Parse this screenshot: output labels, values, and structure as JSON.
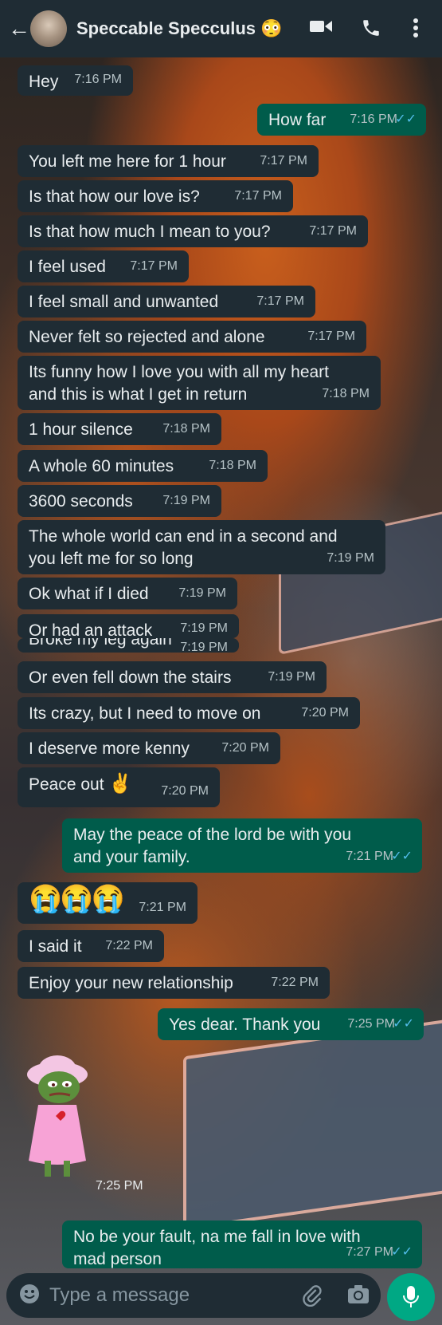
{
  "header": {
    "back_icon": "arrow-left-icon",
    "contact_name": "Speccable Specculus",
    "contact_emoji": "😳",
    "video_icon": "video-call-icon",
    "call_icon": "phone-icon",
    "menu_icon": "more-vert-icon"
  },
  "messages": [
    {
      "dir": "in",
      "text": "Hey",
      "time": "7:16 PM"
    },
    {
      "dir": "out",
      "text": "How far",
      "time": "7:16 PM"
    },
    {
      "dir": "in",
      "text": "You left me here for 1 hour",
      "time": "7:17 PM"
    },
    {
      "dir": "in",
      "text": "Is that how our love is?",
      "time": "7:17 PM"
    },
    {
      "dir": "in",
      "text": "Is that how much I mean to you?",
      "time": "7:17 PM"
    },
    {
      "dir": "in",
      "text": "I feel used",
      "time": "7:17 PM"
    },
    {
      "dir": "in",
      "text": "I feel small and unwanted",
      "time": "7:17 PM"
    },
    {
      "dir": "in",
      "text": "Never felt so rejected and alone",
      "time": "7:17 PM"
    },
    {
      "dir": "in",
      "text": "Its funny how I love you with all my heart",
      "text2": "and this is what I get in return",
      "time": "7:18 PM"
    },
    {
      "dir": "in",
      "text": "1 hour silence",
      "time": "7:18 PM"
    },
    {
      "dir": "in",
      "text": "A whole 60 minutes",
      "time": "7:18 PM"
    },
    {
      "dir": "in",
      "text": "3600 seconds",
      "time": "7:19 PM"
    },
    {
      "dir": "in",
      "text": "The whole world can end in a second and",
      "text2": "you left me for so long",
      "time": "7:19 PM"
    },
    {
      "dir": "in",
      "text": "Ok what if I died",
      "time": "7:19 PM"
    },
    {
      "dir": "in",
      "text": "Or had an attack",
      "time": "7:19 PM"
    },
    {
      "dir": "in",
      "text": "Broke my leg again",
      "time": "7:19 PM"
    },
    {
      "dir": "in",
      "text": "Or even fell down the stairs",
      "time": "7:19 PM"
    },
    {
      "dir": "in",
      "text": "Its crazy, but I need to move on",
      "time": "7:20 PM"
    },
    {
      "dir": "in",
      "text": "I deserve more kenny",
      "time": "7:20 PM"
    },
    {
      "dir": "in",
      "text": "Peace out",
      "emoji": "✌️",
      "time": "7:20 PM"
    },
    {
      "dir": "out",
      "text": "May the peace of the lord be with you",
      "text2": "and your family.",
      "time": "7:21 PM"
    },
    {
      "dir": "in",
      "text": "😭😭😭",
      "time": "7:21 PM"
    },
    {
      "dir": "in",
      "text": "I said it",
      "time": "7:22 PM"
    },
    {
      "dir": "in",
      "text": "Enjoy your new relationship",
      "time": "7:22 PM"
    },
    {
      "dir": "out",
      "text": "Yes dear. Thank you",
      "time": "7:25 PM"
    },
    {
      "dir": "in",
      "sticker": "sad-frog-sticker",
      "time": "7:25 PM"
    },
    {
      "dir": "out",
      "text": "No be your fault, na me fall in love with",
      "text2": "mad person",
      "time": "7:27 PM"
    }
  ],
  "composer": {
    "placeholder": "Type a message",
    "emoji_icon": "emoji-icon",
    "attach_icon": "paperclip-icon",
    "camera_icon": "camera-icon",
    "mic_icon": "microphone-icon"
  },
  "colors": {
    "incoming_bubble": "#1f2c34",
    "outgoing_bubble": "#005c4b",
    "read_tick": "#53bdeb",
    "accent": "#00a884"
  }
}
